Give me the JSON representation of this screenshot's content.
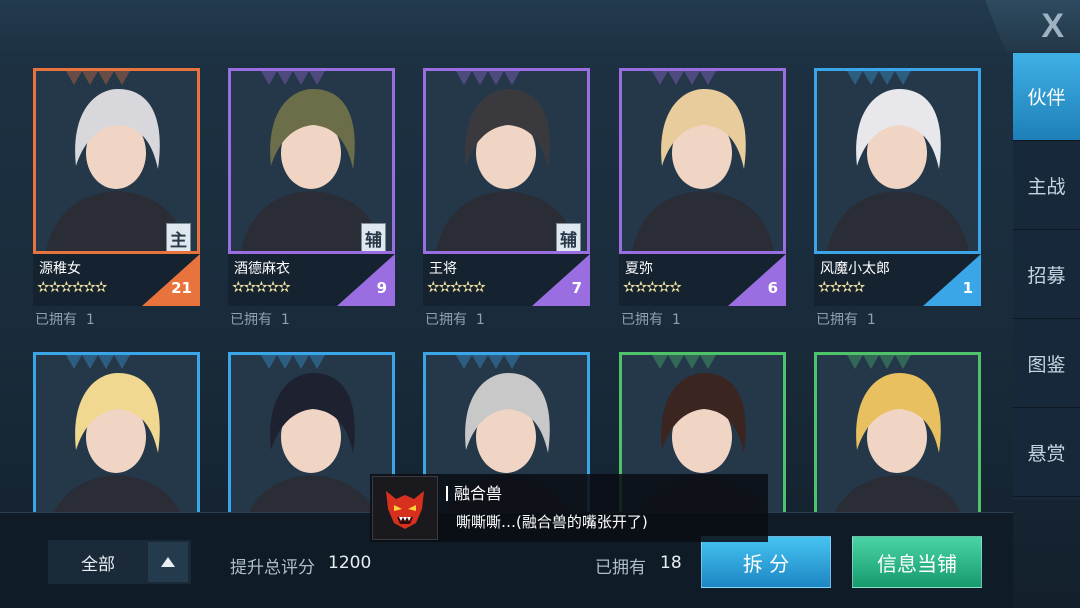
{
  "close_label": "X",
  "sidebar": {
    "tabs": [
      {
        "label": "伙伴",
        "active": true
      },
      {
        "label": "主战",
        "active": false
      },
      {
        "label": "招募",
        "active": false
      },
      {
        "label": "图鉴",
        "active": false
      },
      {
        "label": "悬赏",
        "active": false
      }
    ]
  },
  "cards": [
    {
      "name": "源稚女",
      "stars": "✫✫✫✫✫✫",
      "level": "21",
      "role": "主",
      "owned_label": "已拥有",
      "owned_count": "1",
      "rarity_color": "#e8733c",
      "hair": "#d8d8dc"
    },
    {
      "name": "酒德麻衣",
      "stars": "✫✫✫✫✫",
      "level": "9",
      "role": "辅",
      "owned_label": "已拥有",
      "owned_count": "1",
      "rarity_color": "#9a6ee0",
      "hair": "#6b6e48"
    },
    {
      "name": "王将",
      "stars": "✫✫✫✫✫",
      "level": "7",
      "role": "辅",
      "owned_label": "已拥有",
      "owned_count": "1",
      "rarity_color": "#9a6ee0",
      "hair": "#3a3a3e"
    },
    {
      "name": "夏弥",
      "stars": "✫✫✫✫✫",
      "level": "6",
      "role": "",
      "owned_label": "已拥有",
      "owned_count": "1",
      "rarity_color": "#9a6ee0",
      "hair": "#e8cc9c"
    },
    {
      "name": "风魔小太郎",
      "stars": "✫✫✫✫",
      "level": "1",
      "role": "",
      "owned_label": "已拥有",
      "owned_count": "1",
      "rarity_color": "#3aa6e8",
      "hair": "#e8e8ec"
    },
    {
      "name": "",
      "stars": "",
      "level": "",
      "role": "",
      "owned_label": "",
      "owned_count": "",
      "rarity_color": "#3aa6e8",
      "hair": "#f0d890"
    },
    {
      "name": "",
      "stars": "",
      "level": "",
      "role": "",
      "owned_label": "",
      "owned_count": "",
      "rarity_color": "#3aa6e8",
      "hair": "#1e2230"
    },
    {
      "name": "",
      "stars": "",
      "level": "",
      "role": "",
      "owned_label": "",
      "owned_count": "",
      "rarity_color": "#3aa6e8",
      "hair": "#c8c8c8"
    },
    {
      "name": "",
      "stars": "",
      "level": "",
      "role": "",
      "owned_label": "",
      "owned_count": "",
      "rarity_color": "#4ec46a",
      "hair": "#3a2520"
    },
    {
      "name": "",
      "stars": "",
      "level": "",
      "role": "",
      "owned_label": "",
      "owned_count": "",
      "rarity_color": "#4ec46a",
      "hair": "#e8c060"
    }
  ],
  "bottom": {
    "filter_label": "全部",
    "score_label": "提升总评分",
    "score_value": "1200",
    "owned_label": "已拥有",
    "owned_value": "18",
    "split_label": "拆 分",
    "pawn_label": "信息当铺"
  },
  "dialog": {
    "speaker": "融合兽",
    "text": "嘶嘶嘶…(融合兽的嘴张开了)"
  }
}
